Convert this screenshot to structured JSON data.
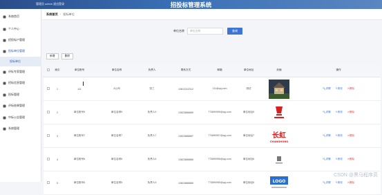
{
  "header": {
    "user_text": "管理员 admin  退出登录",
    "title": "招投标管理系统"
  },
  "sidebar": {
    "items": [
      {
        "label": "系统首页",
        "icon": "home-icon"
      },
      {
        "label": "个人中心",
        "icon": "user-icon"
      },
      {
        "label": "招投标户管理",
        "icon": "users-icon"
      },
      {
        "label": "投标单位管理",
        "icon": "building-icon"
      },
      {
        "label": "投标单位",
        "icon": "",
        "sub": true
      },
      {
        "label": "评标专家管理",
        "icon": "expert-icon"
      },
      {
        "label": "招标信息管理",
        "icon": "doc-icon"
      },
      {
        "label": "投标管理",
        "icon": "bid-icon"
      },
      {
        "label": "评标结果管理",
        "icon": "result-icon"
      },
      {
        "label": "中标公告管理",
        "icon": "notice-icon"
      },
      {
        "label": "系统管理",
        "icon": "gear-icon"
      }
    ]
  },
  "breadcrumb": {
    "home": "系统首页",
    "current": "投标单位"
  },
  "search": {
    "label": "单位名称",
    "placeholder": "单位名称",
    "button": "查询"
  },
  "toolbar": {
    "add": "新增",
    "delete": "删除"
  },
  "table": {
    "headers": [
      "",
      "索引",
      "单位账号",
      "单位名称",
      "负责人",
      "联系方式",
      "邮箱",
      "单位地址",
      "封面",
      "操作"
    ],
    "rows": [
      {
        "idx": "1",
        "account": "111",
        "name": "A公司",
        "person": "张三",
        "phone": "13812312312",
        "email": "111@qq.com",
        "addr": "测试",
        "logo": "house"
      },
      {
        "idx": "2",
        "account": "单位账号9",
        "name": "单位名称9",
        "person": "负责人9",
        "phone": "13823888889",
        "email": "773890999@qq.com",
        "addr": "单位地址9",
        "logo": "red-brand"
      },
      {
        "idx": "3",
        "account": "单位账号7",
        "name": "单位名称7",
        "person": "负责人7",
        "phone": "13823888887",
        "email": "773890997@qq.com",
        "addr": "单位地址7",
        "logo": "changhong"
      },
      {
        "idx": "4",
        "account": "单位账号6",
        "name": "单位名称6",
        "person": "负责人6",
        "phone": "13823888886",
        "email": "773890996@qq.com",
        "addr": "单位地址6",
        "logo": "small"
      },
      {
        "idx": "5",
        "account": "单位账号5",
        "name": "单位名称5",
        "person": "负责人5",
        "phone": "13823888885",
        "email": "773890995@qq.com",
        "addr": "单位地址5",
        "logo": "logo-blue"
      }
    ],
    "actions": {
      "view": "详情",
      "edit": "修改",
      "del": "删除"
    }
  },
  "logos": {
    "changhong_main": "长虹",
    "changhong_sub": "CHANGHONG",
    "logo_blue": "LOGO"
  },
  "watermark": "CSDN @黑马程序员",
  "colors": {
    "accent": "#3d75d6",
    "danger": "#e04848",
    "header": "#2a4d8a"
  }
}
